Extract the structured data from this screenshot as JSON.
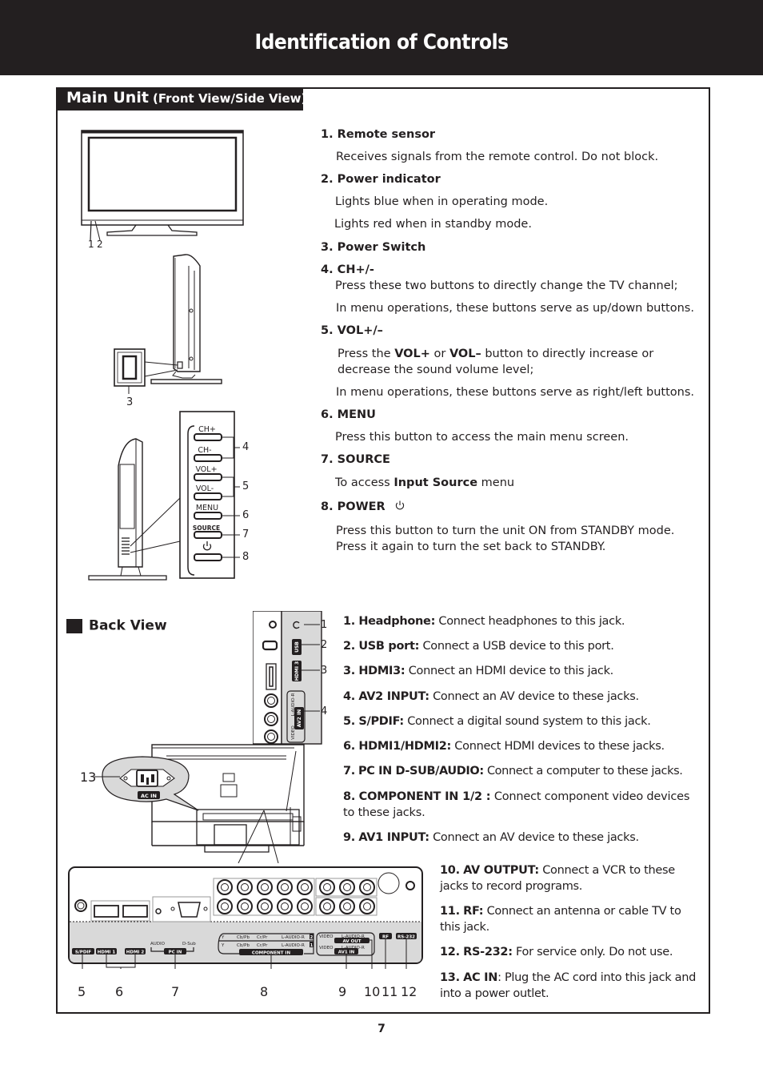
{
  "page": {
    "title": "Identification of Controls",
    "page_number": "7"
  },
  "main_unit": {
    "heading": "Main Unit",
    "subheading": "(Front View/Side View)",
    "diagram_callouts": [
      "1",
      "2",
      "3",
      "4",
      "5",
      "6",
      "7",
      "8"
    ],
    "side_panel_buttons": [
      "CH+",
      "CH-",
      "VOL+",
      "VOL-",
      "MENU",
      "SOURCE",
      "power-icon"
    ],
    "items": [
      {
        "num": "1.",
        "title": "Remote sensor",
        "lines": [
          "Receives signals from the remote control. Do not block."
        ]
      },
      {
        "num": "2.",
        "title": "Power indicator",
        "lines": [
          "Lights blue when in operating mode.",
          "Lights red when in standby mode."
        ]
      },
      {
        "num": "3.",
        "title": "Power Switch",
        "lines": []
      },
      {
        "num": "4.",
        "title": "CH+/-",
        "lines": [
          "Press these two buttons to directly change the TV channel;",
          "In menu operations, these buttons serve as up/down buttons."
        ]
      },
      {
        "num": "5.",
        "title": "VOL+/–",
        "lines": [
          "Press the",
          "VOL+",
          "or",
          "VOL–",
          "button to directly increase or decrease the sound volume level;",
          "In menu operations, these buttons serve as right/left buttons."
        ]
      },
      {
        "num": "6.",
        "title": "MENU",
        "lines": [
          "Press this button to access the main menu screen."
        ]
      },
      {
        "num": "7.",
        "title": "SOURCE",
        "lines": [
          "To access",
          "Input Source",
          "menu"
        ]
      },
      {
        "num": "8.",
        "title": "POWER",
        "icon": "power-icon",
        "lines": [
          "Press this button to turn the unit ON from STANDBY mode.",
          "Press it again to turn the set back to STANDBY."
        ]
      }
    ]
  },
  "back_view": {
    "heading": "Back View",
    "panel_labels": {
      "usb": "USB",
      "hdmi3": "HDMI 3",
      "av2_audio": "L-AUDIO-R",
      "av2_in": "AV2 IN",
      "av2_video": "VIDEO",
      "ac_in": "AC IN",
      "spdif": "S/PDIF",
      "hdmi1": "HDMI 1",
      "hdmi2": "HDMI 2",
      "pc_audio": "AUDIO",
      "pc_dsub": "D-Sub",
      "pc_in": "PC IN",
      "comp_y": "Y",
      "comp_cb": "Cb/Pb",
      "comp_cr": "Cr/Pr",
      "comp_audio": "L-AUDIO-R",
      "comp_2": "2",
      "comp_1": "1",
      "component_in": "COMPONENT IN",
      "video": "VIDEO",
      "av_audio": "L-AUDIO-R",
      "av_out": "AV OUT",
      "av1_in": "AV1 IN",
      "rf": "RF",
      "rs232": "RS-232"
    },
    "diagram_callouts": [
      "1",
      "2",
      "3",
      "4",
      "5",
      "6",
      "7",
      "8",
      "9",
      "10",
      "11",
      "12",
      "13"
    ],
    "items": [
      {
        "num": "1.",
        "title": "Headphone:",
        "text": "Connect headphones to this jack."
      },
      {
        "num": "2.",
        "title": "USB port:",
        "text": "Connect a USB device to this port."
      },
      {
        "num": "3.",
        "title": "HDMI3:",
        "text": "Connect an HDMI device to this jack."
      },
      {
        "num": "4.",
        "title": "AV2 INPUT:",
        "text": "Connect an AV device to these jacks."
      },
      {
        "num": "5.",
        "title": "S/PDIF:",
        "text": "Connect a digital sound system to this jack."
      },
      {
        "num": "6.",
        "title": "HDMI1/HDMI2:",
        "text": "Connect HDMI devices to these jacks."
      },
      {
        "num": "7.",
        "title": "PC IN D-SUB/AUDIO:",
        "text": "Connect a computer to these jacks."
      },
      {
        "num": "8.",
        "title": "COMPONENT IN 1/2 :",
        "text": "Connect component video devices to these jacks."
      },
      {
        "num": "9.",
        "title": "AV1 INPUT:",
        "text": "Connect an AV device to these jacks."
      },
      {
        "num": "10.",
        "title": "AV OUTPUT:",
        "text": "Connect a VCR to these jacks to record programs."
      },
      {
        "num": "11.",
        "title": "RF:",
        "text": "Connect an antenna or cable TV to this jack."
      },
      {
        "num": "12.",
        "title": "RS-232:",
        "text": "For service only. Do not use."
      },
      {
        "num": "13.",
        "title": "AC IN",
        "text": ": Plug the AC cord into this jack and into a power outlet."
      }
    ]
  }
}
